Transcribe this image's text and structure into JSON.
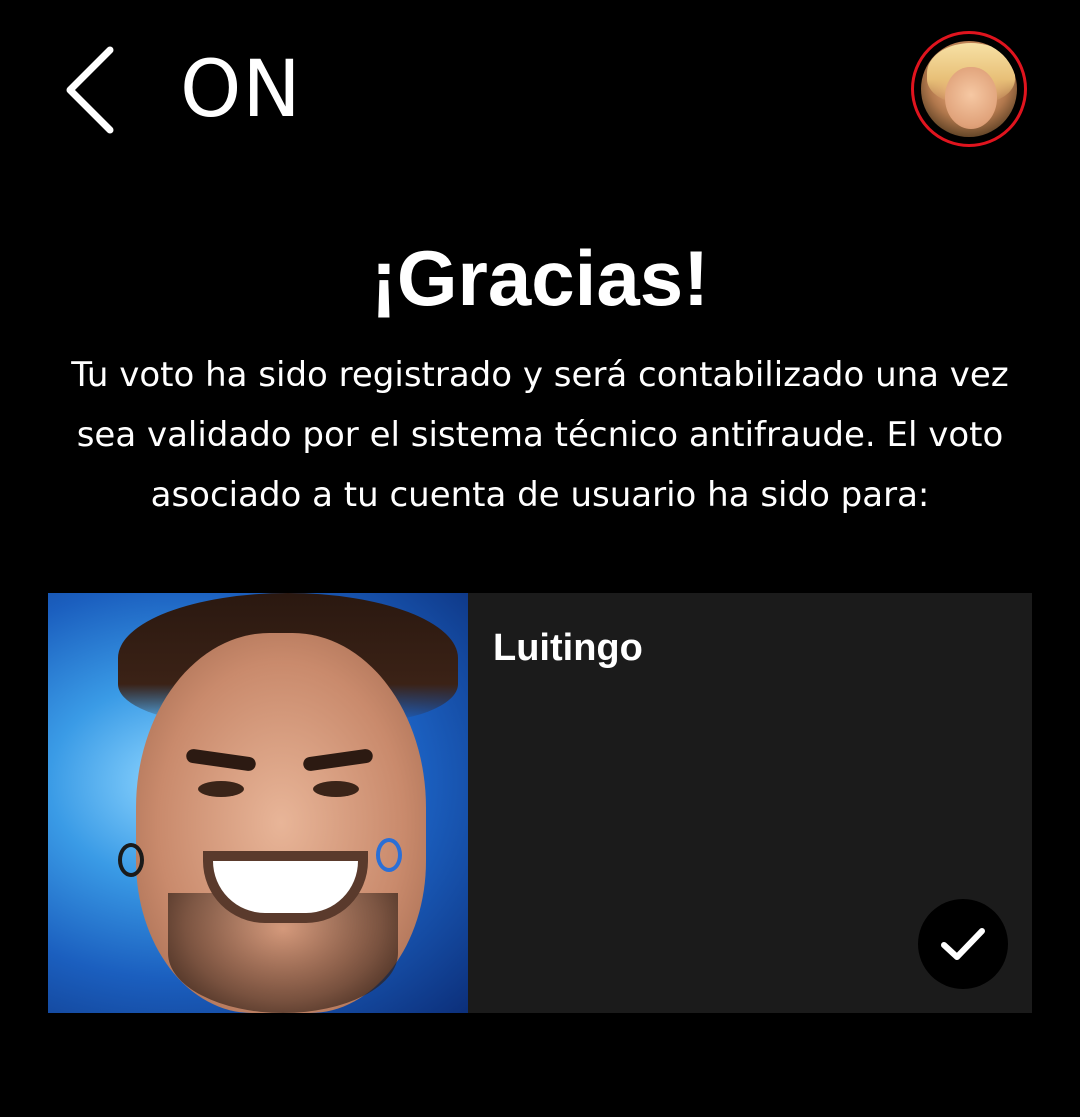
{
  "header": {
    "back_icon": "chevron-left-icon",
    "title": "ON",
    "avatar_icon": "user-avatar"
  },
  "confirmation": {
    "heading": "¡Gracias!",
    "message": "Tu voto ha sido registrado y será contabilizado una vez sea validado por el sistema técnico antifraude. El voto asociado a tu cuenta de usuario ha sido para:"
  },
  "vote_card": {
    "candidate_name": "Luitingo",
    "selected_icon": "checkmark-icon"
  },
  "colors": {
    "background": "#000000",
    "card_background": "#1b1b1b",
    "avatar_ring": "#e0141e",
    "text": "#ffffff"
  }
}
